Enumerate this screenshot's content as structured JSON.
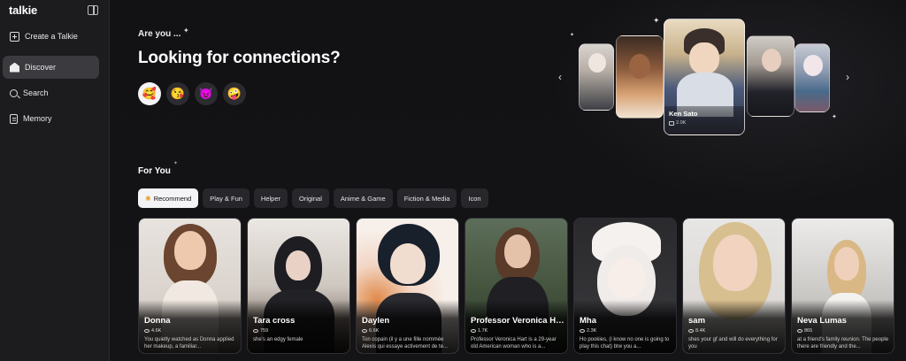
{
  "sidebar": {
    "logo": "talkie",
    "items": [
      {
        "label": "Create a Talkie",
        "icon": "plus-square-icon"
      },
      {
        "label": "Discover",
        "icon": "home-icon",
        "active": true
      },
      {
        "label": "Search",
        "icon": "search-icon"
      },
      {
        "label": "Memory",
        "icon": "memory-icon"
      }
    ]
  },
  "hero": {
    "eyebrow": "Are you ...",
    "headline": "Looking for connections?",
    "emojis": [
      "🥰",
      "😘",
      "😈",
      "🤪"
    ]
  },
  "carousel": {
    "featured": {
      "name": "Ken Sato",
      "count": "2.0K"
    },
    "prev_label": "‹",
    "next_label": "›"
  },
  "for_you": {
    "title": "For You",
    "tabs": [
      "Recommend",
      "Play & Fun",
      "Helper",
      "Original",
      "Anime & Game",
      "Fiction & Media",
      "Icon"
    ],
    "active_tab": "Recommend"
  },
  "cards": [
    {
      "name": "Donna",
      "count": "4.6K",
      "desc": "You quietly watched as Donna applied her makeup, a familiar..."
    },
    {
      "name": "Tara cross",
      "count": "759",
      "desc": "she's an edgy female"
    },
    {
      "name": "Daylen",
      "count": "6.6K",
      "desc": "Ton copain (il y a une fille nommée Alexis qui essaye activement de te..."
    },
    {
      "name": "Professor Veronica Hart",
      "count": "1.7K",
      "desc": "Professor Veronica Hart is a 29-year old American woman who is a..."
    },
    {
      "name": "Mha",
      "count": "2.3K",
      "desc": "Ho pookies, (i know no one is going to play this chat) btw you a..."
    },
    {
      "name": "sam",
      "count": "8.4K",
      "desc": "shes your gf and will do everything for you"
    },
    {
      "name": "Neva Lumas",
      "count": "865",
      "desc": "at a friend's family reunion. The people there are friendly and the..."
    }
  ]
}
